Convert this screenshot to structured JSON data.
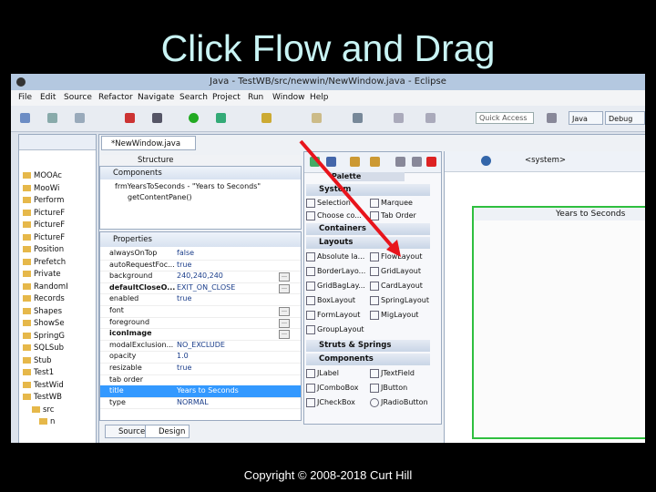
{
  "slide": {
    "title": "Click Flow and Drag",
    "copyright": "Copyright © 2008-2018 Curt Hill"
  },
  "window": {
    "title": "Java - TestWB/src/newwin/NewWindow.java - Eclipse"
  },
  "menu": [
    "File",
    "Edit",
    "Source",
    "Refactor",
    "Navigate",
    "Search",
    "Project",
    "Run",
    "Window",
    "Help"
  ],
  "toolbar": {
    "quick_access": "Quick Access",
    "perspectives": [
      "Java",
      "Debug"
    ]
  },
  "package_explorer": {
    "items": [
      "MOOAc",
      "MooWi",
      "Perform",
      "PictureF",
      "PictureF",
      "PictureF",
      "Position",
      "Prefetch",
      "Private",
      "RandomI",
      "Records",
      "Shapes",
      "ShowSe",
      "SpringG",
      "SQLSub",
      "Stub",
      "Test1",
      "TestWid",
      "TestWB",
      "src",
      "n"
    ]
  },
  "editor": {
    "tab": "*NewWindow.java",
    "structure_label": "Structure",
    "components": {
      "title": "Components",
      "root": "frmYearsToSeconds - \"Years to Seconds\"",
      "child": "getContentPane()"
    },
    "properties": {
      "title": "Properties",
      "rows": [
        {
          "name": "alwaysOnTop",
          "value": "false"
        },
        {
          "name": "autoRequestFoc...",
          "value": "true"
        },
        {
          "name": "background",
          "value": "240,240,240"
        },
        {
          "name": "defaultCloseO...",
          "value": "EXIT_ON_CLOSE"
        },
        {
          "name": "enabled",
          "value": "true"
        },
        {
          "name": "font",
          "value": ""
        },
        {
          "name": "foreground",
          "value": ""
        },
        {
          "name": "iconImage",
          "value": ""
        },
        {
          "name": "modalExclusion...",
          "value": "NO_EXCLUDE"
        },
        {
          "name": "opacity",
          "value": "1.0"
        },
        {
          "name": "resizable",
          "value": "true"
        },
        {
          "name": "tab order",
          "value": ""
        },
        {
          "name": "title",
          "value": "Years to Seconds"
        },
        {
          "name": "type",
          "value": "NORMAL"
        }
      ]
    },
    "bottom_tabs": [
      "Source",
      "Design"
    ],
    "system_combo": "<system>",
    "palette": {
      "title": "Palette",
      "categories": [
        {
          "name": "System",
          "items": [
            "Selection",
            "Marquee",
            "Choose co...",
            "Tab Order"
          ]
        },
        {
          "name": "Containers",
          "items": []
        },
        {
          "name": "Layouts",
          "items": [
            "Absolute la...",
            "FlowLayout",
            "BorderLayo...",
            "GridLayout",
            "GridBagLay...",
            "CardLayout",
            "BoxLayout",
            "SpringLayout",
            "FormLayout",
            "MigLayout",
            "GroupLayout"
          ]
        },
        {
          "name": "Struts & Springs",
          "items": []
        },
        {
          "name": "Components",
          "items": [
            "JLabel",
            "JTextField",
            "JComboBox",
            "JButton",
            "JCheckBox",
            "JRadioButton"
          ]
        }
      ]
    },
    "frame_title": "Years to Seconds"
  },
  "colors": {
    "title_text": "#c9f4f4",
    "arrow": "#e8141c",
    "frame_border": "#2fbf3f",
    "selection": "#3399ff"
  }
}
